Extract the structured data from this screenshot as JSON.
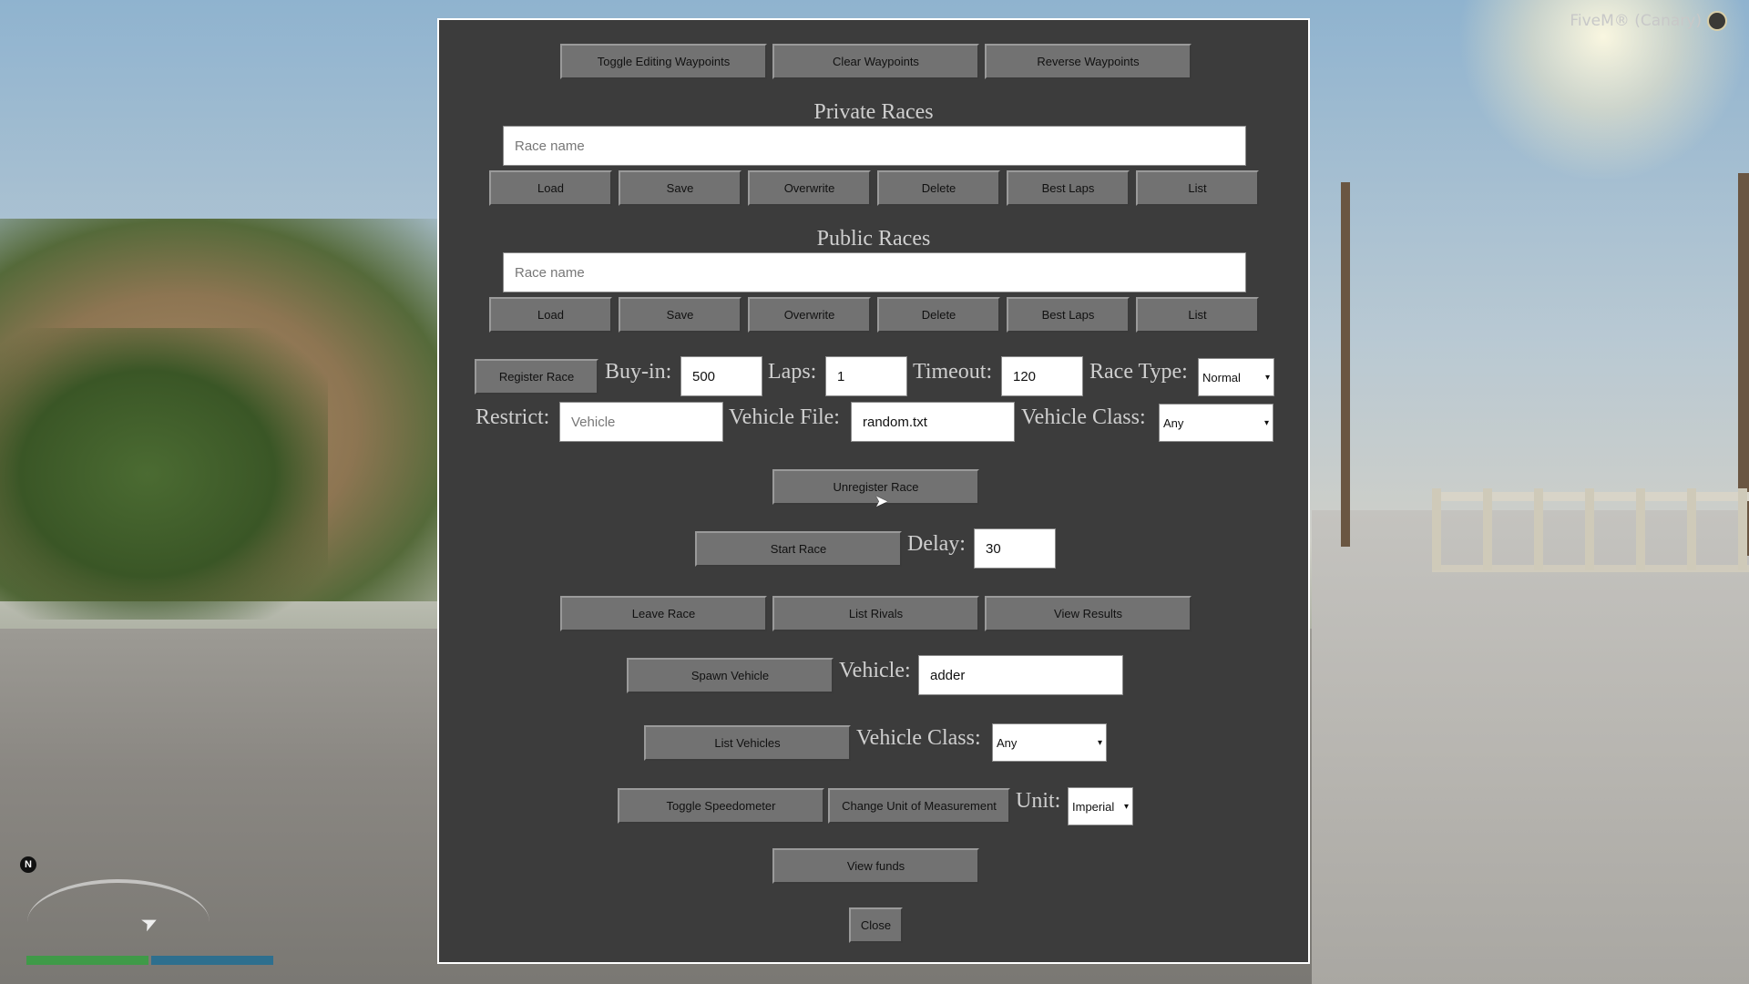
{
  "brand": {
    "text": "FiveM® (Canary)"
  },
  "hud": {
    "compass": "N",
    "player_icon": "arrow-icon"
  },
  "toolbar": {
    "toggle_waypoints": "Toggle Editing Waypoints",
    "clear_waypoints": "Clear Waypoints",
    "reverse_waypoints": "Reverse Waypoints"
  },
  "private_races": {
    "title": "Private Races",
    "placeholder": "Race name",
    "buttons": [
      "Load",
      "Save",
      "Overwrite",
      "Delete",
      "Best Laps",
      "List"
    ]
  },
  "public_races": {
    "title": "Public Races",
    "placeholder": "Race name",
    "buttons": [
      "Load",
      "Save",
      "Overwrite",
      "Delete",
      "Best Laps",
      "List"
    ]
  },
  "register": {
    "button": "Register Race",
    "buyin_label": "Buy-in:",
    "buyin_value": "500",
    "laps_label": "Laps:",
    "laps_value": "1",
    "timeout_label": "Timeout:",
    "timeout_value": "120",
    "racetype_label": "Race Type:",
    "racetype_value": "Normal",
    "restrict_label": "Restrict:",
    "restrict_placeholder": "Vehicle",
    "vehiclefile_label": "Vehicle File:",
    "vehiclefile_value": "random.txt",
    "vehicleclass_label": "Vehicle Class:",
    "vehicleclass_value": "Any"
  },
  "unregister": {
    "button": "Unregister Race"
  },
  "start": {
    "button": "Start Race",
    "delay_label": "Delay:",
    "delay_value": "30"
  },
  "race_actions": {
    "leave": "Leave Race",
    "rivals": "List Rivals",
    "results": "View Results"
  },
  "spawn": {
    "button": "Spawn Vehicle",
    "label": "Vehicle:",
    "value": "adder"
  },
  "list_vehicles": {
    "button": "List Vehicles",
    "label": "Vehicle Class:",
    "value": "Any"
  },
  "speedometer": {
    "toggle": "Toggle Speedometer",
    "change_unit": "Change Unit of Measurement",
    "unit_label": "Unit:",
    "unit_value": "Imperial"
  },
  "funds": {
    "button": "View funds"
  },
  "close": {
    "button": "Close"
  }
}
